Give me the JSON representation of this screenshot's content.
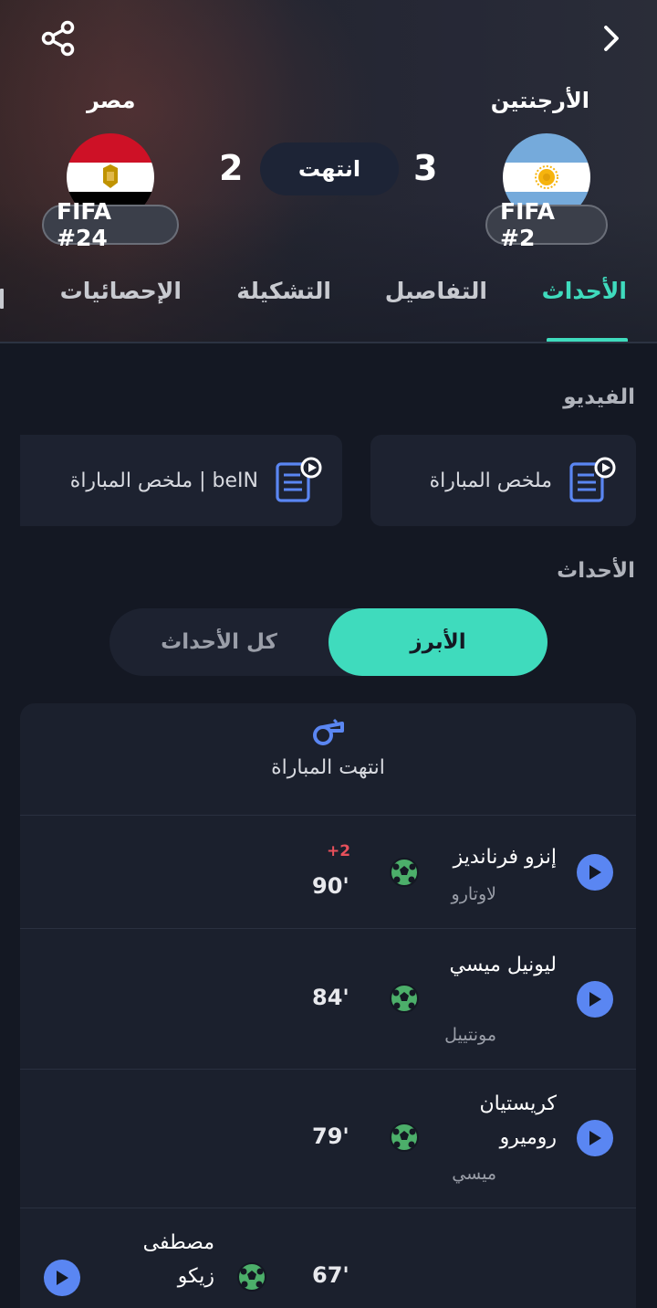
{
  "header": {
    "home_team": {
      "name": "الأرجنتين",
      "rank": "FIFA #2",
      "score": "3"
    },
    "away_team": {
      "name": "مصر",
      "rank": "FIFA #24",
      "score": "2"
    },
    "status": "انتهت",
    "share_icon": "share-icon",
    "back_icon": "chevron-right-icon"
  },
  "tabs": [
    {
      "label": "الأحداث",
      "active": true
    },
    {
      "label": "التفاصيل"
    },
    {
      "label": "التشكيلة"
    },
    {
      "label": "الإحصائيات"
    }
  ],
  "video": {
    "title": "الفيديو",
    "cards": [
      {
        "label": "ملخص المباراة",
        "icon": "video-doc-icon"
      },
      {
        "label": "ملخص المباراة | beIN",
        "icon": "video-doc-icon"
      }
    ]
  },
  "events": {
    "title": "الأحداث",
    "toggle": {
      "highlights": "الأبرز",
      "all": "كل الأحداث"
    },
    "match_end": "انتهت المباراة",
    "items": [
      {
        "player": "إنزو فرنانديز",
        "assist": "لاوتارو",
        "minute": "90'",
        "extra": "+2",
        "icon": "football-icon"
      },
      {
        "player": "ليونيل ميسي",
        "assist": "مونتييل",
        "minute": "84'",
        "icon": "football-icon"
      },
      {
        "player": "كريستيان روميرو",
        "assist": "ميسي",
        "minute": "79'",
        "icon": "football-icon"
      },
      {
        "player": "مصطفى زيكو",
        "minute": "67'",
        "icon": "football-icon"
      }
    ]
  },
  "colors": {
    "accent": "#3fdbbd",
    "play": "#5a86f2",
    "ball": "#4caf6a",
    "extra_time": "#e8505b"
  }
}
